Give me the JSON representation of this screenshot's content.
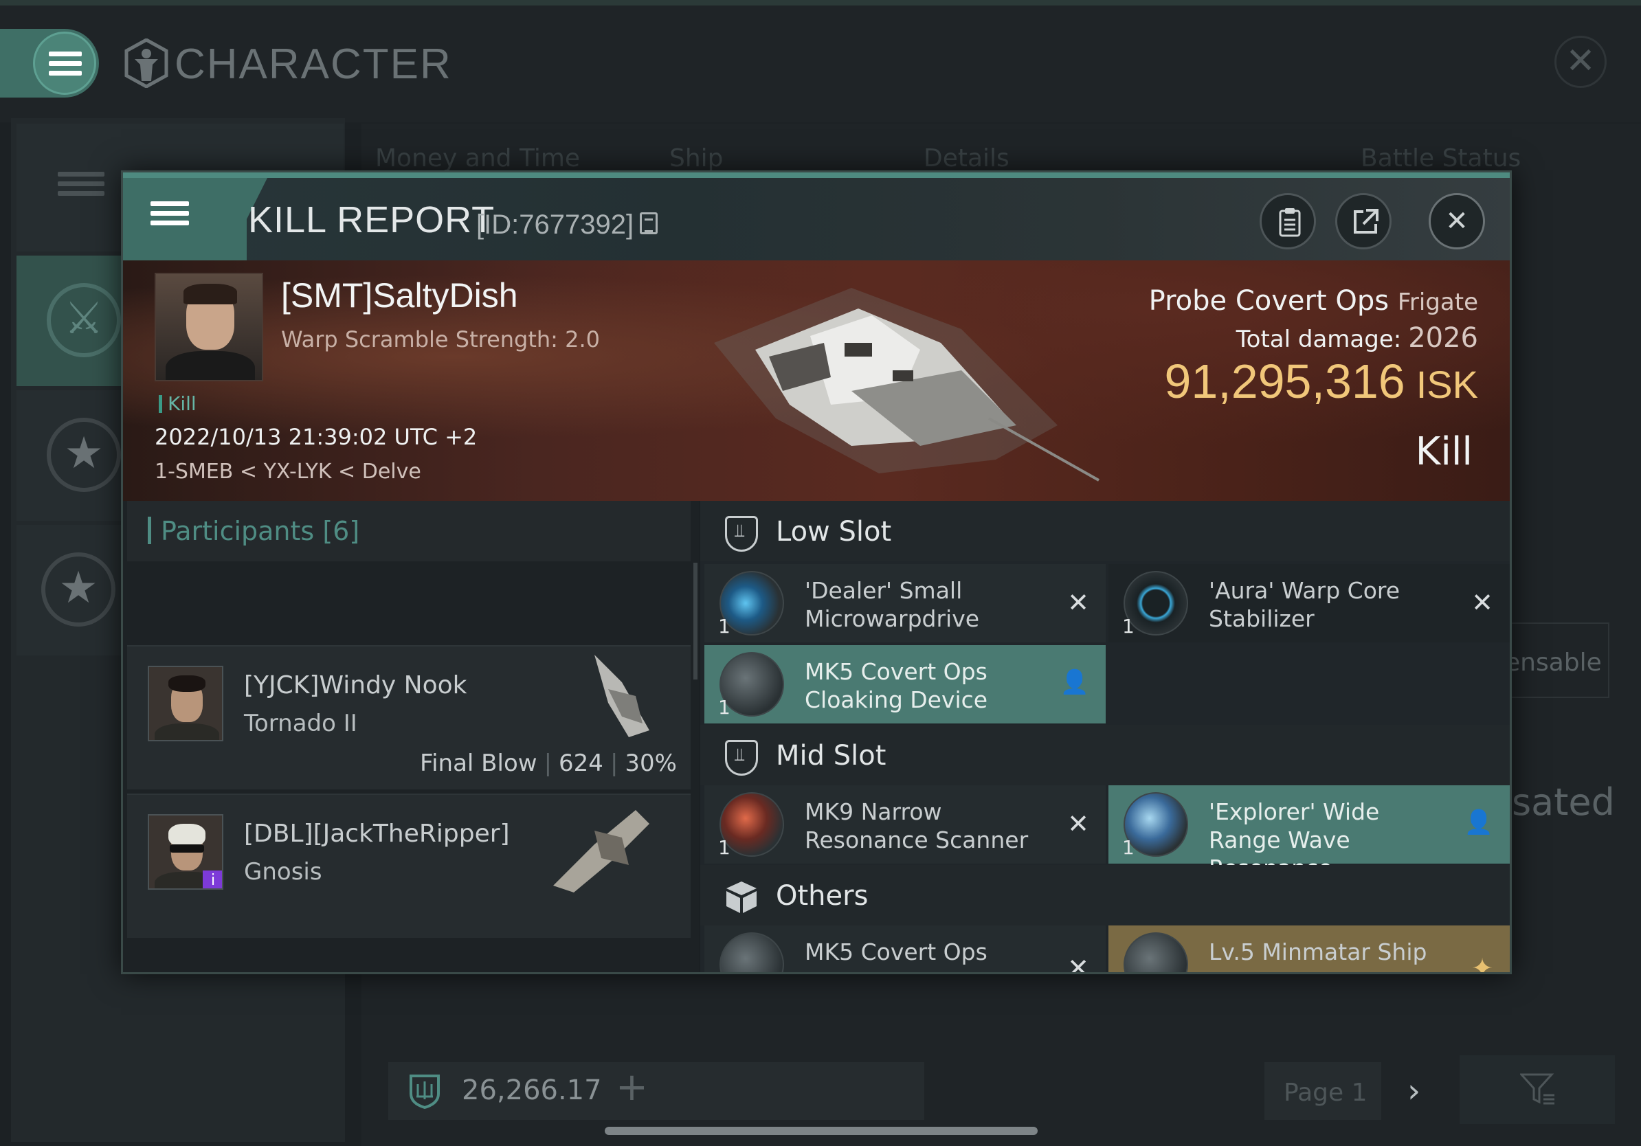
{
  "app": {
    "title": "CHARACTER"
  },
  "background": {
    "tabs": [
      "Money and Time",
      "Ship",
      "Details",
      "Battle Status"
    ],
    "ghost_text_1": "ensable",
    "ghost_text_2": "sated",
    "balance": "26,266.17",
    "page_label": "Page 1"
  },
  "kill_report": {
    "title": "KILL REPORT",
    "id_label": "[ID:7677392]",
    "victim": {
      "name": "[SMT]SaltyDish",
      "subtitle": "Warp Scramble Strength: 2.0",
      "badge": "Kill",
      "datetime": "2022/10/13 21:39:02 UTC +2",
      "location": "1-SMEB < YX-LYK < Delve"
    },
    "ship": {
      "name": "Probe Covert Ops",
      "class": "Frigate",
      "damage_label": "Total damage:",
      "damage_value": "2026",
      "isk_value": "91,295,316",
      "isk_unit": "ISK",
      "result": "Kill"
    },
    "participants": {
      "label": "Participants",
      "count": "[6]",
      "rows": [
        {
          "name": "[YJCK]Windy Nook",
          "ship": "Tornado II",
          "final_blow": "Final Blow",
          "damage": "624",
          "percent": "30%"
        },
        {
          "name": "[DBL][JackTheRipper]",
          "ship": "Gnosis",
          "badge": "i"
        }
      ]
    },
    "slots": [
      {
        "title": "Low Slot",
        "modules": [
          {
            "name": "'Dealer' Small Microwarpdrive",
            "qty": "1",
            "state": "destroyed"
          },
          {
            "name": "'Aura' Warp Core Stabilizer",
            "qty": "1",
            "state": "destroyed"
          },
          {
            "name": "MK5 Covert Ops Cloaking Device",
            "qty": "1",
            "state": "dropped"
          }
        ]
      },
      {
        "title": "Mid Slot",
        "modules": [
          {
            "name": "MK9 Narrow Resonance Scanner",
            "qty": "1",
            "state": "destroyed"
          },
          {
            "name": "'Explorer' Wide Range Wave Resonance...",
            "qty": "1",
            "state": "dropped"
          }
        ]
      },
      {
        "title": "Others",
        "modules": [
          {
            "name": "MK5 Covert Ops",
            "qty": "",
            "state": "destroyed"
          },
          {
            "name": "Lv.5 Minmatar Ship",
            "qty": "",
            "state": "special"
          }
        ]
      }
    ]
  },
  "icons": {
    "destroyed": "close-icon",
    "dropped": "person-icon"
  },
  "colors": {
    "accent": "#4e8a80",
    "isk": "#f1c77a",
    "dropped_row": "#4a7a72",
    "special_row": "#7a6a44"
  }
}
